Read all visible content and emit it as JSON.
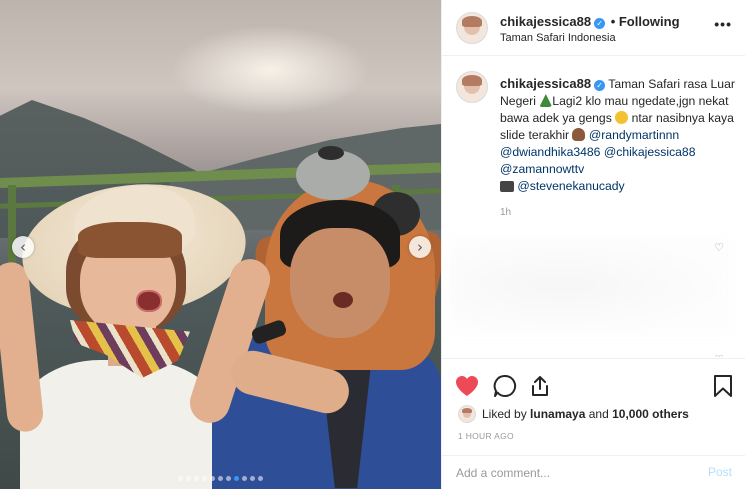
{
  "post": {
    "username": "chikajessica88",
    "follow_status": "• Following",
    "location": "Taman Safari Indonesia",
    "more_icon": "more-options-icon",
    "caption_text_1": "Taman Safari rasa Luar Negeri ",
    "caption_text_2": "Lagi2 klo mau ngedate,jgn nekat bawa adek ya gengs ",
    "caption_text_3": " ntar nasibnya kaya slide terakhir ",
    "mentions": [
      "@randymartinnn",
      "@dwiandhika3486",
      "@chikajessica88",
      "@zamannowttv"
    ],
    "camera_mention": "@stevenekanucady",
    "caption_time": "1h",
    "likes_text_prefix": "Liked by ",
    "liked_by_user": "lunamaya",
    "likes_text_and": " and ",
    "likes_count": "10,000 others",
    "posted_ago": "1 HOUR AGO"
  },
  "carousel": {
    "total_dots": 11,
    "active_dot": 7
  },
  "comment": {
    "placeholder": "Add a comment...",
    "post_label": "Post"
  },
  "colors": {
    "accent": "#3897f0",
    "like_red": "#ed4956",
    "mention": "#003569",
    "post_disabled": "#b2dffc"
  }
}
